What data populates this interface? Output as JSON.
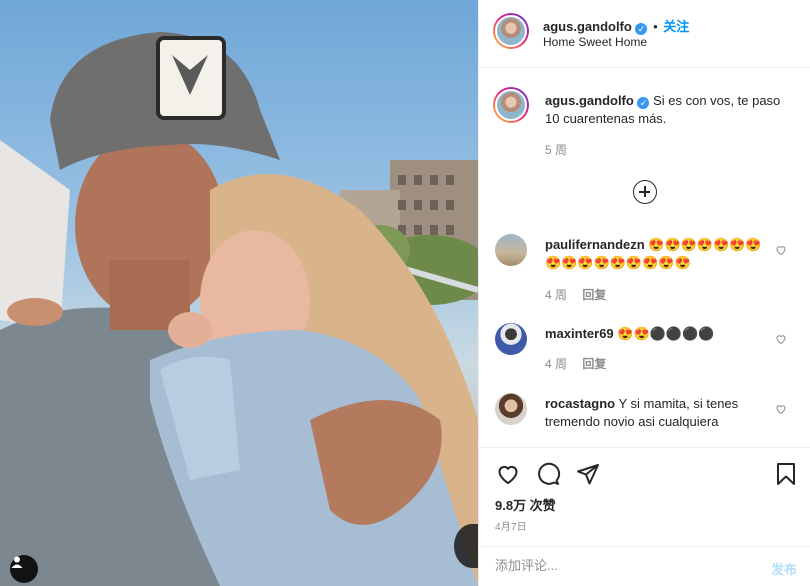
{
  "post": {
    "author": {
      "username": "agus.gandolfo",
      "verified": true,
      "follow_label": "关注",
      "separator": "•",
      "location": "Home Sweet Home"
    },
    "caption": {
      "username": "agus.gandolfo",
      "text": "Si es con vos, te paso 10 cuarentenas más.",
      "time": "5 周"
    },
    "comments": [
      {
        "username": "paulifernandezn",
        "text": "😍😍😍😍😍😍😍😍😍😍😍😍😍😍😍😍",
        "time": "4 周",
        "reply_label": "回复"
      },
      {
        "username": "maxinter69",
        "text": "😍😍⚫⚫⚫⚫",
        "time": "4 周",
        "reply_label": "回复"
      },
      {
        "username": "rocastagno",
        "text": "Y si mamita, si tenes tremendo novio asi cualquiera",
        "time": "",
        "reply_label": ""
      }
    ],
    "likes": "9.8万 次赞",
    "date": "4月7日",
    "add_comment_placeholder": "添加评论...",
    "post_button": "发布",
    "icons": {
      "like": "heart-icon",
      "comment": "comment-icon",
      "share": "share-icon",
      "save": "bookmark-icon",
      "more_comments": "plus-circle-icon",
      "tag": "user-tag-icon"
    },
    "colors": {
      "link": "#0095f6",
      "verified": "#3897f0",
      "muted": "#8e8e8e",
      "post_disabled": "#b2dffc"
    }
  }
}
